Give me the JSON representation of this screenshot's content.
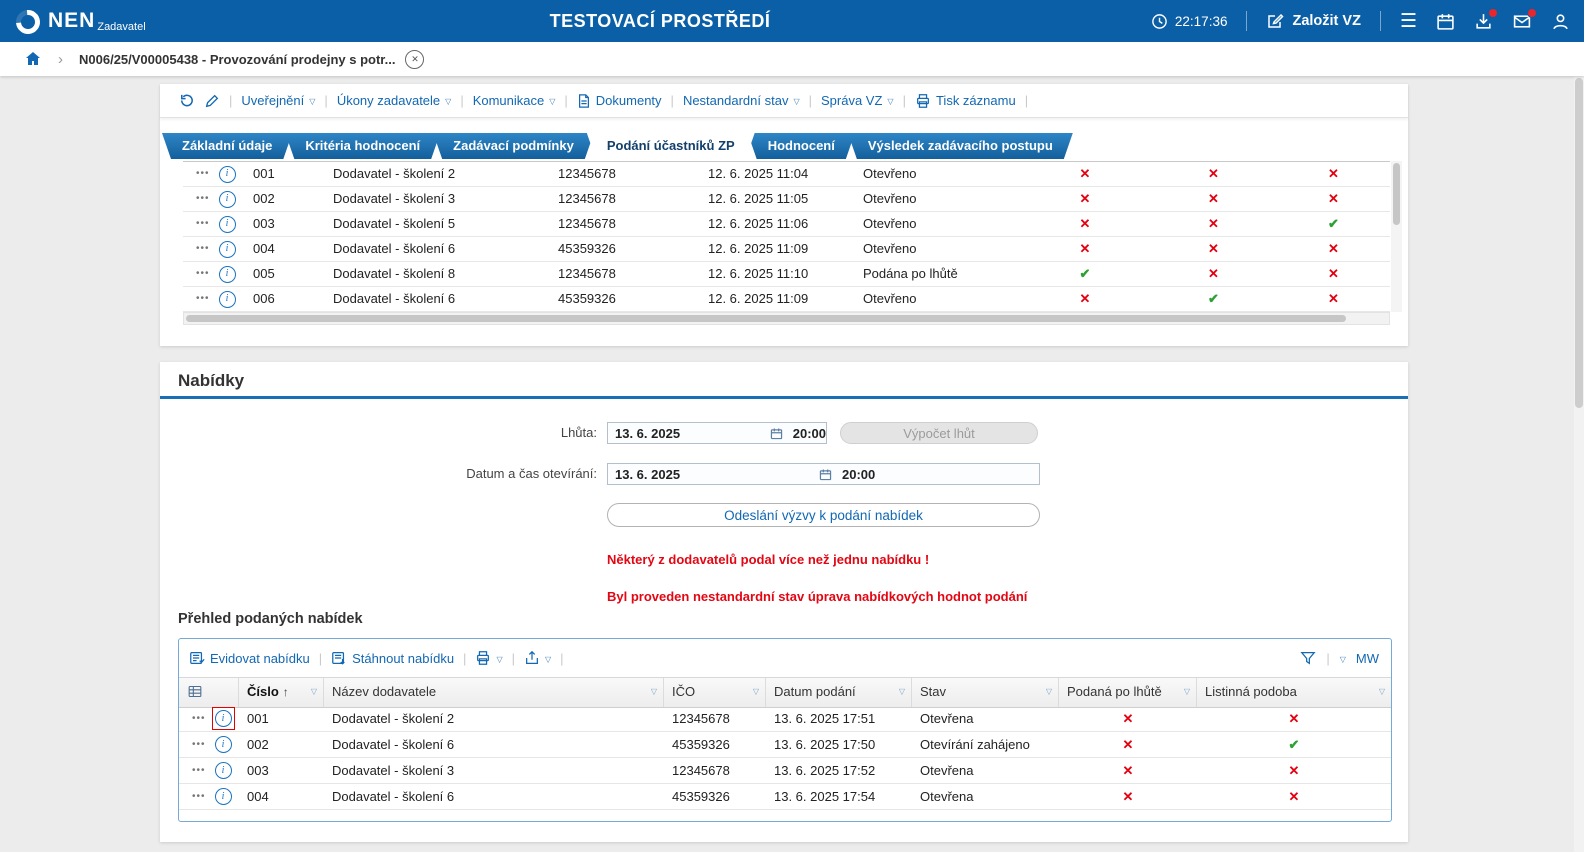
{
  "header": {
    "brand": "NEN",
    "brand_sub": "Zadavatel",
    "env_title": "TESTOVACÍ PROSTŘEDÍ",
    "time": "22:17:36",
    "create_vz": "Založit VZ"
  },
  "breadcrumb": {
    "item": "N006/25/V00005438 - Provozování prodejny s potr..."
  },
  "toolbar": {
    "items": [
      {
        "label": "Uveřejnění"
      },
      {
        "label": "Úkony zadavatele"
      },
      {
        "label": "Komunikace"
      },
      {
        "label": "Dokumenty"
      },
      {
        "label": "Nestandardní stav"
      },
      {
        "label": "Správa VZ"
      },
      {
        "label": "Tisk záznamu"
      }
    ]
  },
  "tabs": {
    "active": 3,
    "items": [
      "Základní údaje",
      "Kritéria hodnocení",
      "Zadávací podmínky",
      "Podání účastníků ZP",
      "Hodnocení",
      "Výsledek zadávacího postupu"
    ]
  },
  "participants": {
    "rows": [
      {
        "cislo": "001",
        "nazev": "Dodavatel - školení 2",
        "ico": "12345678",
        "datum": "12. 6. 2025 11:04",
        "stav": "Otevřeno",
        "marks": [
          false,
          false,
          false
        ]
      },
      {
        "cislo": "002",
        "nazev": "Dodavatel - školení 3",
        "ico": "12345678",
        "datum": "12. 6. 2025 11:05",
        "stav": "Otevřeno",
        "marks": [
          false,
          false,
          false
        ]
      },
      {
        "cislo": "003",
        "nazev": "Dodavatel - školení 5",
        "ico": "12345678",
        "datum": "12. 6. 2025 11:06",
        "stav": "Otevřeno",
        "marks": [
          false,
          false,
          true
        ]
      },
      {
        "cislo": "004",
        "nazev": "Dodavatel - školení 6",
        "ico": "45359326",
        "datum": "12. 6. 2025 11:09",
        "stav": "Otevřeno",
        "marks": [
          false,
          false,
          false
        ]
      },
      {
        "cislo": "005",
        "nazev": "Dodavatel - školení 8",
        "ico": "12345678",
        "datum": "12. 6. 2025 11:10",
        "stav": "Podána po lhůtě",
        "marks": [
          true,
          false,
          false
        ]
      },
      {
        "cislo": "006",
        "nazev": "Dodavatel - školení 6",
        "ico": "45359326",
        "datum": "12. 6. 2025 11:09",
        "stav": "Otevřeno",
        "marks": [
          false,
          true,
          false
        ]
      }
    ]
  },
  "nabidky": {
    "title": "Nabídky",
    "lhuta_label": "Lhůta:",
    "lhuta_date": "13. 6. 2025",
    "lhuta_time": "20:00",
    "vypocet_button": "Výpočet lhůt",
    "oteviranie_label": "Datum a čas otevírání:",
    "oteviranie_date": "13. 6. 2025",
    "oteviranie_time": "20:00",
    "send_button": "Odeslání výzvy k podání nabídek",
    "warning1": "Některý z dodavatelů podal více než jednu nabídku !",
    "warning2": "Byl proveden nestandardní stav úprava nabídkových hodnot podání"
  },
  "offers": {
    "title": "Přehled podaných nabídek",
    "toolbar": {
      "evidovat": "Evidovat nabídku",
      "stahnout": "Stáhnout nabídku",
      "mw": "MW"
    },
    "columns": [
      "Číslo",
      "Název dodavatele",
      "IČO",
      "Datum podání",
      "Stav",
      "Podaná po lhůtě",
      "Listinná podoba"
    ],
    "rows": [
      {
        "cislo": "001",
        "nazev": "Dodavatel - školení 2",
        "ico": "12345678",
        "datum": "13. 6. 2025 17:51",
        "stav": "Otevřena",
        "po_lhute": false,
        "listinna": false,
        "highlight": true
      },
      {
        "cislo": "002",
        "nazev": "Dodavatel - školení 6",
        "ico": "45359326",
        "datum": "13. 6. 2025 17:50",
        "stav": "Otevírání zahájeno",
        "po_lhute": false,
        "listinna": true,
        "highlight": false
      },
      {
        "cislo": "003",
        "nazev": "Dodavatel - školení 3",
        "ico": "12345678",
        "datum": "13. 6. 2025 17:52",
        "stav": "Otevřena",
        "po_lhute": false,
        "listinna": false,
        "highlight": false
      },
      {
        "cislo": "004",
        "nazev": "Dodavatel - školení 6",
        "ico": "45359326",
        "datum": "13. 6. 2025 17:54",
        "stav": "Otevřena",
        "po_lhute": false,
        "listinna": false,
        "highlight": false
      }
    ]
  },
  "icons": {
    "menu": "☰",
    "dots": "•••",
    "check": "✔",
    "cross": "✕",
    "caret": "▽",
    "sort_asc": "↑",
    "chevron": "›",
    "close": "✕"
  }
}
